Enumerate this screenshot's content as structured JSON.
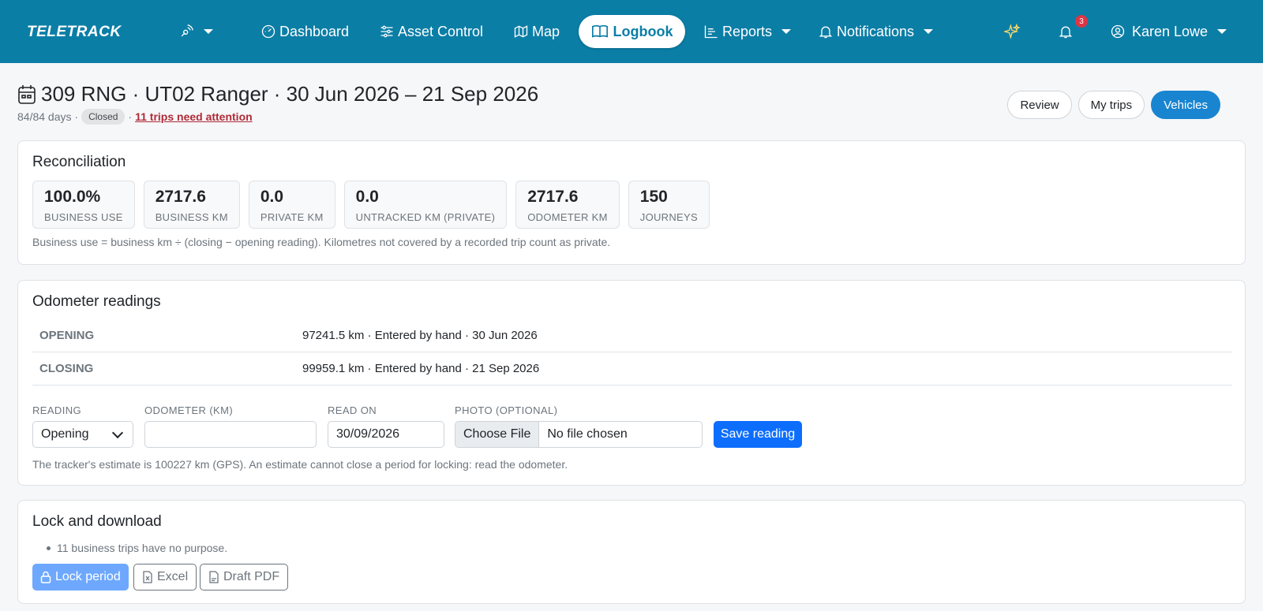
{
  "nav": {
    "brand": "TELETRACK",
    "items": {
      "dashboard": "Dashboard",
      "asset_control": "Asset Control",
      "map": "Map",
      "logbook": "Logbook",
      "reports": "Reports",
      "notifications": "Notifications"
    },
    "alert_count": "3",
    "user": "Karen Lowe"
  },
  "header": {
    "title": "309 RNG · UT02 Ranger · 30 Jun 2026 – 21 Sep 2026",
    "days": "84/84 days ·",
    "status": "Closed",
    "separator": "·",
    "attention": "11 trips need attention",
    "buttons": {
      "review": "Review",
      "my_trips": "My trips",
      "vehicles": "Vehicles"
    }
  },
  "reconciliation": {
    "title": "Reconciliation",
    "stats": [
      {
        "value": "100.0%",
        "label": "BUSINESS USE"
      },
      {
        "value": "2717.6",
        "label": "BUSINESS KM"
      },
      {
        "value": "0.0",
        "label": "PRIVATE KM"
      },
      {
        "value": "0.0",
        "label": "UNTRACKED KM (PRIVATE)"
      },
      {
        "value": "2717.6",
        "label": "ODOMETER KM"
      },
      {
        "value": "150",
        "label": "JOURNEYS"
      }
    ],
    "note": "Business use = business km ÷ (closing − opening reading). Kilometres not covered by a recorded trip count as private."
  },
  "odometer": {
    "title": "Odometer readings",
    "rows": [
      {
        "key": "OPENING",
        "value": "97241.5 km · Entered by hand · 30 Jun 2026"
      },
      {
        "key": "CLOSING",
        "value": "99959.1 km · Entered by hand · 21 Sep 2026"
      }
    ],
    "form": {
      "reading_label": "READING",
      "reading_value": "Opening",
      "odometer_label": "ODOMETER (KM)",
      "odometer_value": "",
      "read_on_label": "READ ON",
      "read_on_value": "30/09/2026",
      "photo_label": "PHOTO (OPTIONAL)",
      "choose_file": "Choose File",
      "no_file": "No file chosen",
      "save": "Save reading"
    },
    "note": "The tracker's estimate is 100227 km (GPS). An estimate cannot close a period for locking: read the odometer."
  },
  "lock": {
    "title": "Lock and download",
    "issue": "11 business trips have no purpose.",
    "lock_button": "Lock period",
    "excel_button": "Excel",
    "pdf_button": "Draft PDF"
  },
  "colors": {
    "navbar": "#0b7ea6",
    "primary": "#0d6efd",
    "danger": "#dc3545"
  }
}
